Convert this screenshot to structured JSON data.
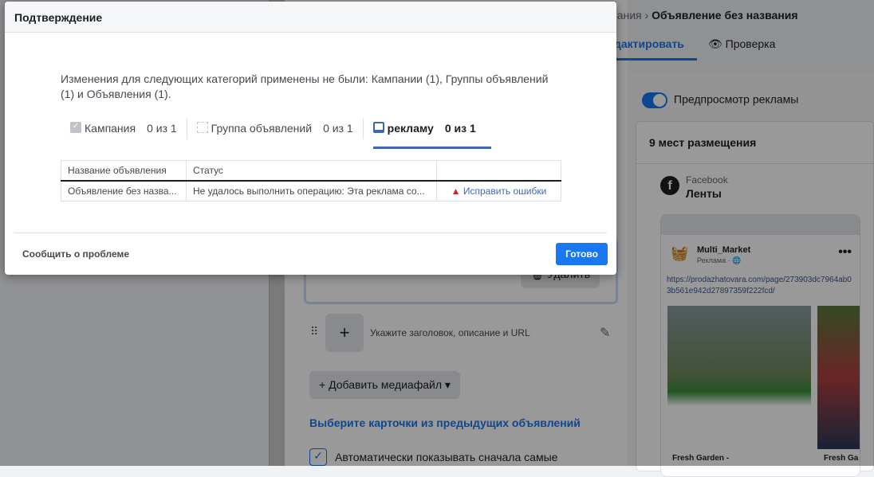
{
  "background": {
    "breadcrumb_prev": "звания",
    "breadcrumb_current": "Объявление без названия",
    "tab_edit": "дактировать",
    "tab_review": "Проверка",
    "delete_label": "Удалить",
    "card_placeholder": "Укажите заголовок, описание и URL",
    "add_media": "Добавить медиафайл",
    "choose_cards": "Выберите карточки из предыдущих объявлений",
    "auto_show": "Автоматически показывать сначала самые",
    "preview_toggle": "Предпросмотр рекламы",
    "placements": "9 мест размещения",
    "platform": "Facebook",
    "placement_name": "Ленты",
    "advertiser": "Multi_Market",
    "sponsored": "Реклама · ",
    "url": "https://prodazhatovara.com/page/273903dc7964ab03b561e942d27897359f222fcd/",
    "card1_title": "Fresh Garden -",
    "card2_title": "Fresh Ga"
  },
  "modal": {
    "title": "Подтверждение",
    "message": "Изменения для следующих категорий применены не были: Кампании (1), Группы объявлений (1) и Объявления (1).",
    "tabs": [
      {
        "label": "Кампания",
        "count": "0 из 1",
        "icon": "campaign-check-icon"
      },
      {
        "label": "Группа объявлений",
        "count": "0 из 1",
        "icon": "adset-grid-icon"
      },
      {
        "label": "рекламу",
        "count": "0 из 1",
        "icon": "ad-tablet-icon",
        "active": true
      }
    ],
    "table": {
      "headers": [
        "Название объявления",
        "Статус",
        ""
      ],
      "rows": [
        {
          "name": "Объявление без назва...",
          "status": "Не удалось выполнить операцию: Эта реклама со...",
          "action": "Исправить ошибки"
        }
      ]
    },
    "report": "Сообщить о проблеме",
    "done": "Готово"
  },
  "colors": {
    "accent": "#1877f2",
    "error": "#e02020"
  }
}
